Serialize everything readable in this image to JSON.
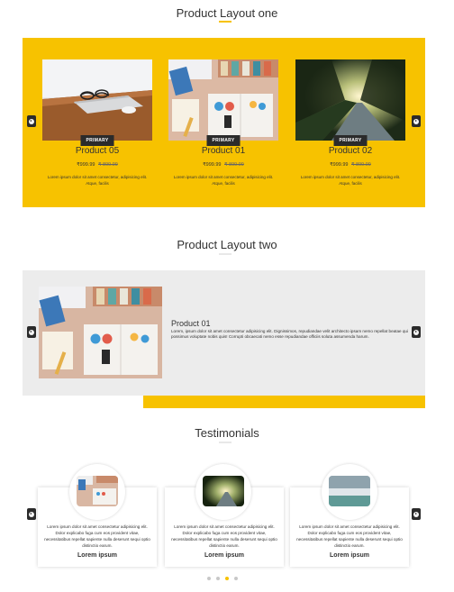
{
  "layout_one": {
    "title": "Product Layout one",
    "products": [
      {
        "name": "Product 05",
        "badge": "PRIMARY",
        "price": "₹999.99",
        "old_price": "₹ 899.99",
        "desc": "Lorem ipsum dolor sit amet consectetur, adipisicing elit. Atque, facilis"
      },
      {
        "name": "Product 01",
        "badge": "PRIMARY",
        "price": "₹999.99",
        "old_price": "₹ 899.99",
        "desc": "Lorem ipsum dolor sit amet consectetur, adipisicing elit. Atque, facilis"
      },
      {
        "name": "Product 02",
        "badge": "PRIMARY",
        "price": "₹999.99",
        "old_price": "₹ 899.99",
        "desc": "Lorem ipsum dolor sit amet consectetur, adipisicing elit. Atque, facilis"
      }
    ]
  },
  "layout_two": {
    "title": "Product Layout two",
    "product_name": "Product 01",
    "desc": "Lorem, ipsum dolor sit amet consectetur adipisicing elit. Dignissimos, repudiandae velit architecto ipsam nemo repellat beatae qui possimus voluptate nobis quis! Corrupti obcaecati nemo esse repudiandae officiis soluta assumenda harum."
  },
  "testimonials": {
    "title": "Testimonials",
    "items": [
      {
        "text": "Lorem ipsum dolor sit amet consectetur adipisicing elit. Dolor explicabo fuga cum eos provident vitae, necessitatibus repellat sapiente nulla deserunt sequi optio distinctio earum.",
        "name": "Lorem ipsum"
      },
      {
        "text": "Lorem ipsum dolor sit amet consectetur adipisicing elit. Dolor explicabo fuga cum eos provident vitae, necessitatibus repellat sapiente nulla deserunt sequi optio distinctio earum.",
        "name": "Lorem ipsum"
      },
      {
        "text": "Lorem ipsum dolor sit amet consectetur adipisicing elit. Dolor explicabo fuga cum eos provident vitae, necessitatibus repellat sapiente nulla deserunt sequi optio distinctio earum.",
        "name": "Lorem ipsum"
      }
    ],
    "active_dot": 3
  },
  "colors": {
    "accent": "#f7c200",
    "dark": "#2b2b2b",
    "grey_band": "#ececec"
  },
  "icons": {
    "prev": "chevron-left-icon",
    "next": "chevron-right-icon"
  }
}
